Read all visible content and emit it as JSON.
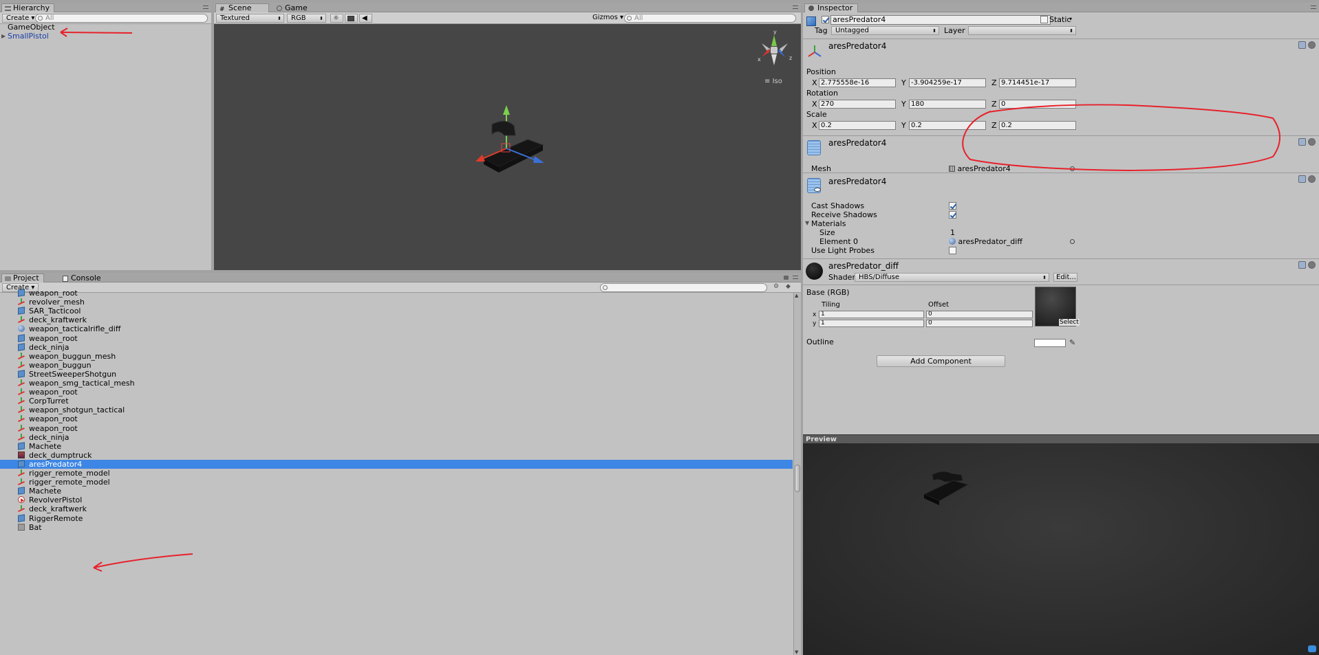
{
  "hierarchy": {
    "tab": "Hierarchy",
    "create": "Create",
    "search_placeholder": "All",
    "items": [
      "GameObject",
      "SmallPistol"
    ]
  },
  "scene": {
    "tab_scene": "Scene",
    "tab_game": "Game",
    "render_mode": "Textured",
    "channel": "RGB",
    "gizmos": "Gizmos",
    "search_placeholder": "All",
    "gizmo_axes": {
      "y": "y",
      "x": "x",
      "z": "z"
    },
    "iso": "Iso"
  },
  "project": {
    "tab_project": "Project",
    "tab_console": "Console",
    "create": "Create",
    "items": [
      {
        "name": "weapon_root",
        "icon": "prefab-icon"
      },
      {
        "name": "revolver_mesh",
        "icon": "mesh-icon"
      },
      {
        "name": "SAR_Tacticool",
        "icon": "prefab-icon"
      },
      {
        "name": "deck_kraftwerk",
        "icon": "mesh-icon"
      },
      {
        "name": "weapon_tacticalrifle_diff",
        "icon": "material-icon"
      },
      {
        "name": "weapon_root",
        "icon": "prefab-icon"
      },
      {
        "name": "deck_ninja",
        "icon": "prefab-icon"
      },
      {
        "name": "weapon_buggun_mesh",
        "icon": "mesh-icon"
      },
      {
        "name": "weapon_buggun",
        "icon": "mesh-icon"
      },
      {
        "name": "StreetSweeperShotgun",
        "icon": "prefab-icon"
      },
      {
        "name": "weapon_smg_tactical_mesh",
        "icon": "mesh-icon"
      },
      {
        "name": "weapon_root",
        "icon": "mesh-icon"
      },
      {
        "name": "CorpTurret",
        "icon": "mesh-icon"
      },
      {
        "name": "weapon_shotgun_tactical",
        "icon": "mesh-icon"
      },
      {
        "name": "weapon_root",
        "icon": "mesh-icon"
      },
      {
        "name": "weapon_root",
        "icon": "mesh-icon"
      },
      {
        "name": "deck_ninja",
        "icon": "mesh-icon"
      },
      {
        "name": "Machete",
        "icon": "prefab-icon"
      },
      {
        "name": "deck_dumptruck",
        "icon": "texture-icon"
      },
      {
        "name": "aresPredator4",
        "icon": "prefab-icon"
      },
      {
        "name": "rigger_remote_model",
        "icon": "mesh-icon"
      },
      {
        "name": "rigger_remote_model",
        "icon": "mesh-icon"
      },
      {
        "name": "Machete",
        "icon": "prefab-icon"
      },
      {
        "name": "RevolverPistol",
        "icon": "script-icon"
      },
      {
        "name": "deck_kraftwerk",
        "icon": "mesh-icon"
      },
      {
        "name": "RiggerRemote",
        "icon": "prefab-icon"
      },
      {
        "name": "Bat",
        "icon": "terrain-icon"
      }
    ],
    "selected_index": 19
  },
  "inspector": {
    "tab": "Inspector",
    "object_name": "aresPredator4",
    "static_label": "Static",
    "tag_label": "Tag",
    "tag_value": "Untagged",
    "layer_label": "Layer",
    "layer_value": "",
    "transform": {
      "name": "aresPredator4",
      "position_label": "Position",
      "rotation_label": "Rotation",
      "scale_label": "Scale",
      "axis_x": "X",
      "axis_y": "Y",
      "axis_z": "Z",
      "position": {
        "x": "2.775558e-16",
        "y": "-3.904259e-17",
        "z": "9.714451e-17"
      },
      "rotation": {
        "x": "270",
        "y": "180",
        "z": "0"
      },
      "scale": {
        "x": "0.2",
        "y": "0.2",
        "z": "0.2"
      }
    },
    "mesh_filter": {
      "name": "aresPredator4",
      "mesh_label": "Mesh",
      "mesh_value": "aresPredator4"
    },
    "mesh_renderer": {
      "name": "aresPredator4",
      "cast_shadows": "Cast Shadows",
      "receive_shadows": "Receive Shadows",
      "materials": "Materials",
      "size_label": "Size",
      "size_value": "1",
      "element0_label": "Element 0",
      "element0_value": "aresPredator_diff",
      "light_probes": "Use Light Probes"
    },
    "material": {
      "name": "aresPredator_diff",
      "shader_label": "Shader",
      "shader_value": "HBS/Diffuse",
      "edit": "Edit...",
      "base_label": "Base (RGB)",
      "tiling": "Tiling",
      "offset": "Offset",
      "x": "x",
      "y": "y",
      "tiling_x": "1",
      "tiling_y": "1",
      "offset_x": "0",
      "offset_y": "0",
      "select": "Select",
      "outline": "Outline"
    },
    "add_component": "Add Component",
    "preview": "Preview"
  },
  "colors": {
    "selection": "#3d86e5",
    "annotation": "#e8202a",
    "scene_bg": "#464646"
  }
}
